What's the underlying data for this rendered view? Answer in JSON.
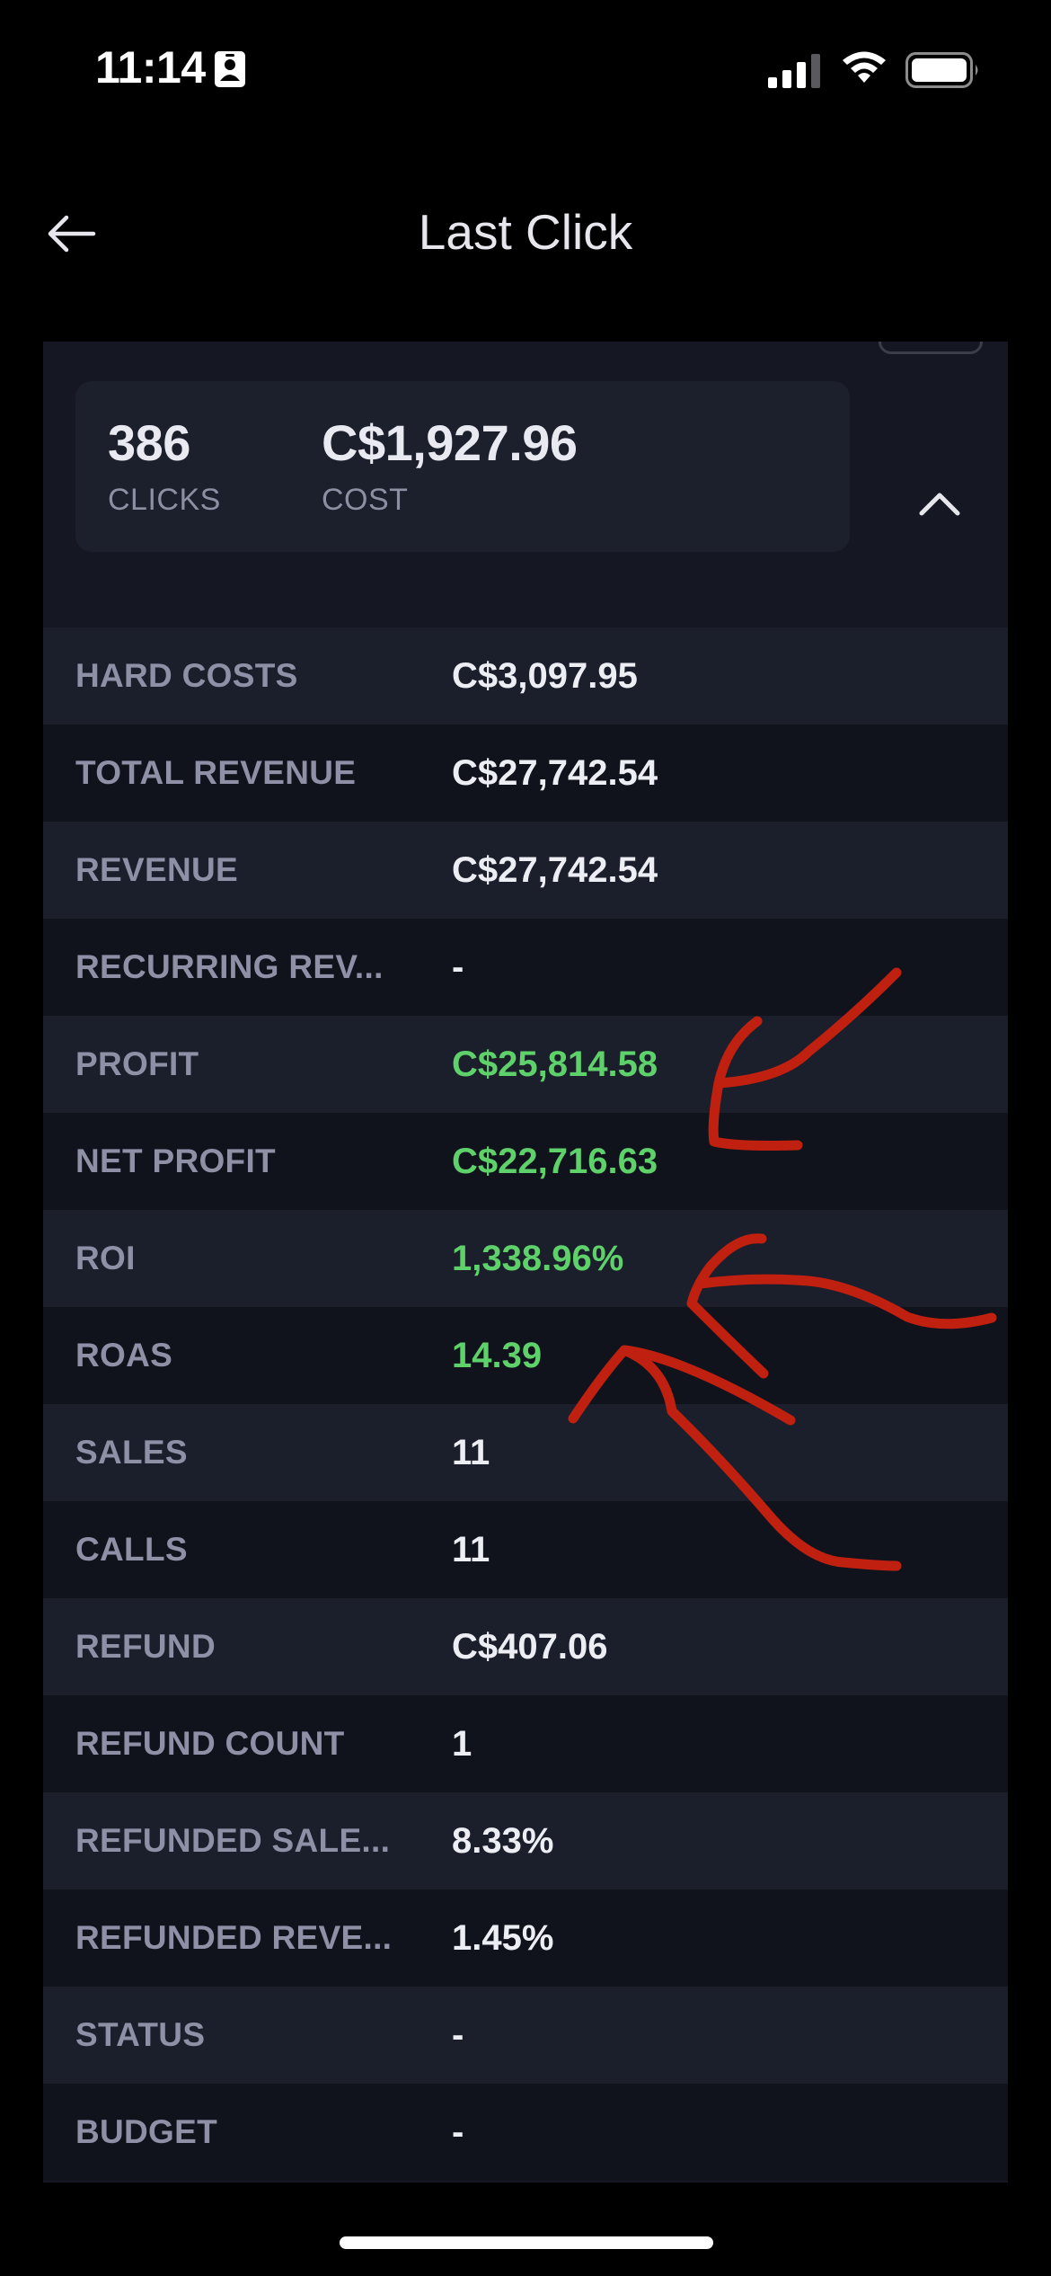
{
  "status_bar": {
    "time": "11:14",
    "icons": [
      "id-card-icon",
      "cellular-signal-icon",
      "wifi-icon",
      "battery-icon"
    ]
  },
  "nav": {
    "title": "Last Click",
    "back_icon": "arrow-left-icon"
  },
  "summary": {
    "clicks_value": "386",
    "clicks_label": "CLICKS",
    "cost_value": "C$1,927.96",
    "cost_label": "COST",
    "collapse_icon": "chevron-up-icon"
  },
  "rows": [
    {
      "label": "HARD COSTS",
      "value": "C$3,097.95",
      "highlight": false
    },
    {
      "label": "TOTAL REVENUE",
      "value": "C$27,742.54",
      "highlight": false
    },
    {
      "label": "REVENUE",
      "value": "C$27,742.54",
      "highlight": false
    },
    {
      "label": "RECURRING REV...",
      "value": "-",
      "highlight": false
    },
    {
      "label": "PROFIT",
      "value": "C$25,814.58",
      "highlight": true
    },
    {
      "label": "NET PROFIT",
      "value": "C$22,716.63",
      "highlight": true
    },
    {
      "label": "ROI",
      "value": "1,338.96%",
      "highlight": true
    },
    {
      "label": "ROAS",
      "value": "14.39",
      "highlight": true
    },
    {
      "label": "SALES",
      "value": "11",
      "highlight": false
    },
    {
      "label": "CALLS",
      "value": "11",
      "highlight": false
    },
    {
      "label": "REFUND",
      "value": "C$407.06",
      "highlight": false
    },
    {
      "label": "REFUND COUNT",
      "value": "1",
      "highlight": false
    },
    {
      "label": "REFUNDED SALE...",
      "value": "8.33%",
      "highlight": false
    },
    {
      "label": "REFUNDED REVE...",
      "value": "1.45%",
      "highlight": false
    },
    {
      "label": "STATUS",
      "value": "-",
      "highlight": false
    },
    {
      "label": "BUDGET",
      "value": "-",
      "highlight": false
    }
  ],
  "colors": {
    "background": "#000000",
    "panel": "#151823",
    "row_alt_1": "#1b1e2b",
    "row_alt_2": "#11131c",
    "positive_value": "#5fd16b",
    "annotation_ink": "#c0200f"
  }
}
